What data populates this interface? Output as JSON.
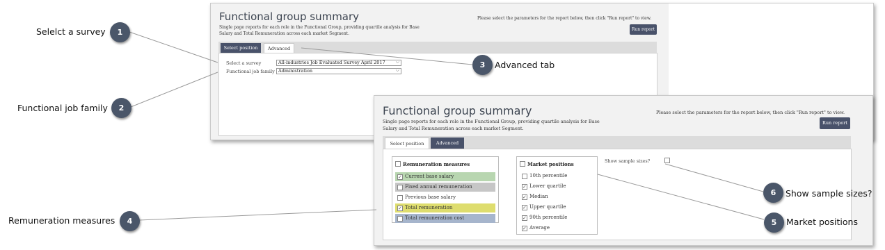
{
  "page": {
    "title": "Functional group summary",
    "subtitle_line1": "Single page reports for each role in the Functional Group, providing quartile analysis for Base",
    "subtitle_line2": "Salary and Total Remuneration across each market Segment.",
    "hint": "Please select the parameters for the report below, then click \"Run report\" to view.",
    "run_button": "Run report"
  },
  "tabs": {
    "select_position": "Select position",
    "advanced": "Advanced"
  },
  "form": {
    "survey_label": "Select a survey",
    "survey_value": "All-industries Job Evaluated Survey April 2017",
    "family_label": "Functional job family",
    "family_value": "Administration"
  },
  "remuneration": {
    "header": "Remuneration measures",
    "header_checked": false,
    "items": [
      {
        "label": "Current base salary",
        "checked": true,
        "color": "#b8d6b0"
      },
      {
        "label": "Fixed annual remuneration",
        "checked": false,
        "color": "#c6c6c6"
      },
      {
        "label": "Previous base salary",
        "checked": false,
        "color": "#ffffff"
      },
      {
        "label": "Total remuneration",
        "checked": true,
        "color": "#dedd6e"
      },
      {
        "label": "Total remuneration cost",
        "checked": false,
        "color": "#a6b5cc"
      }
    ]
  },
  "market": {
    "header": "Market positions",
    "header_checked": false,
    "items": [
      {
        "label": "10th percentile",
        "checked": false
      },
      {
        "label": "Lower quartile",
        "checked": true
      },
      {
        "label": "Median",
        "checked": true
      },
      {
        "label": "Upper quartile",
        "checked": true
      },
      {
        "label": "90th percentile",
        "checked": true
      },
      {
        "label": "Average",
        "checked": true
      }
    ]
  },
  "sample_sizes": {
    "label": "Show sample sizes?",
    "checked": false
  },
  "callouts": [
    {
      "num": "1",
      "text": "Selelct a survey"
    },
    {
      "num": "2",
      "text": "Functional job family"
    },
    {
      "num": "3",
      "text": "Advanced tab"
    },
    {
      "num": "4",
      "text": "Remuneration measures"
    },
    {
      "num": "5",
      "text": "Market positions"
    },
    {
      "num": "6",
      "text": "Show sample sizes?"
    }
  ],
  "colors": {
    "accent": "#49526a",
    "badge": "#4a5669"
  }
}
